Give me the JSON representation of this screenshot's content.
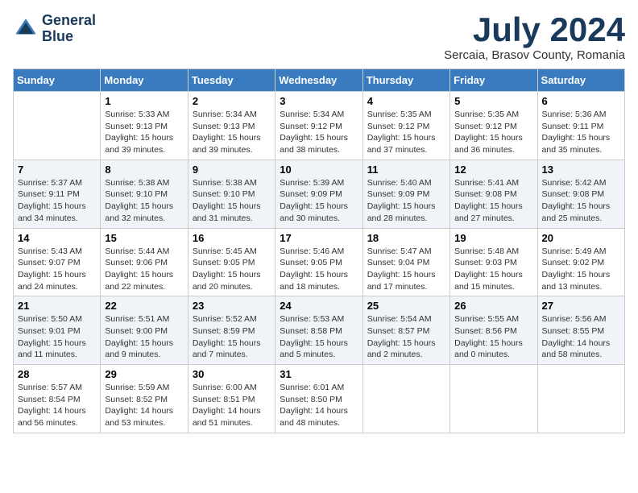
{
  "header": {
    "logo_line1": "General",
    "logo_line2": "Blue",
    "month_year": "July 2024",
    "location": "Sercaia, Brasov County, Romania"
  },
  "weekdays": [
    "Sunday",
    "Monday",
    "Tuesday",
    "Wednesday",
    "Thursday",
    "Friday",
    "Saturday"
  ],
  "weeks": [
    [
      {
        "day": "",
        "info": ""
      },
      {
        "day": "1",
        "info": "Sunrise: 5:33 AM\nSunset: 9:13 PM\nDaylight: 15 hours\nand 39 minutes."
      },
      {
        "day": "2",
        "info": "Sunrise: 5:34 AM\nSunset: 9:13 PM\nDaylight: 15 hours\nand 39 minutes."
      },
      {
        "day": "3",
        "info": "Sunrise: 5:34 AM\nSunset: 9:12 PM\nDaylight: 15 hours\nand 38 minutes."
      },
      {
        "day": "4",
        "info": "Sunrise: 5:35 AM\nSunset: 9:12 PM\nDaylight: 15 hours\nand 37 minutes."
      },
      {
        "day": "5",
        "info": "Sunrise: 5:35 AM\nSunset: 9:12 PM\nDaylight: 15 hours\nand 36 minutes."
      },
      {
        "day": "6",
        "info": "Sunrise: 5:36 AM\nSunset: 9:11 PM\nDaylight: 15 hours\nand 35 minutes."
      }
    ],
    [
      {
        "day": "7",
        "info": "Sunrise: 5:37 AM\nSunset: 9:11 PM\nDaylight: 15 hours\nand 34 minutes."
      },
      {
        "day": "8",
        "info": "Sunrise: 5:38 AM\nSunset: 9:10 PM\nDaylight: 15 hours\nand 32 minutes."
      },
      {
        "day": "9",
        "info": "Sunrise: 5:38 AM\nSunset: 9:10 PM\nDaylight: 15 hours\nand 31 minutes."
      },
      {
        "day": "10",
        "info": "Sunrise: 5:39 AM\nSunset: 9:09 PM\nDaylight: 15 hours\nand 30 minutes."
      },
      {
        "day": "11",
        "info": "Sunrise: 5:40 AM\nSunset: 9:09 PM\nDaylight: 15 hours\nand 28 minutes."
      },
      {
        "day": "12",
        "info": "Sunrise: 5:41 AM\nSunset: 9:08 PM\nDaylight: 15 hours\nand 27 minutes."
      },
      {
        "day": "13",
        "info": "Sunrise: 5:42 AM\nSunset: 9:08 PM\nDaylight: 15 hours\nand 25 minutes."
      }
    ],
    [
      {
        "day": "14",
        "info": "Sunrise: 5:43 AM\nSunset: 9:07 PM\nDaylight: 15 hours\nand 24 minutes."
      },
      {
        "day": "15",
        "info": "Sunrise: 5:44 AM\nSunset: 9:06 PM\nDaylight: 15 hours\nand 22 minutes."
      },
      {
        "day": "16",
        "info": "Sunrise: 5:45 AM\nSunset: 9:05 PM\nDaylight: 15 hours\nand 20 minutes."
      },
      {
        "day": "17",
        "info": "Sunrise: 5:46 AM\nSunset: 9:05 PM\nDaylight: 15 hours\nand 18 minutes."
      },
      {
        "day": "18",
        "info": "Sunrise: 5:47 AM\nSunset: 9:04 PM\nDaylight: 15 hours\nand 17 minutes."
      },
      {
        "day": "19",
        "info": "Sunrise: 5:48 AM\nSunset: 9:03 PM\nDaylight: 15 hours\nand 15 minutes."
      },
      {
        "day": "20",
        "info": "Sunrise: 5:49 AM\nSunset: 9:02 PM\nDaylight: 15 hours\nand 13 minutes."
      }
    ],
    [
      {
        "day": "21",
        "info": "Sunrise: 5:50 AM\nSunset: 9:01 PM\nDaylight: 15 hours\nand 11 minutes."
      },
      {
        "day": "22",
        "info": "Sunrise: 5:51 AM\nSunset: 9:00 PM\nDaylight: 15 hours\nand 9 minutes."
      },
      {
        "day": "23",
        "info": "Sunrise: 5:52 AM\nSunset: 8:59 PM\nDaylight: 15 hours\nand 7 minutes."
      },
      {
        "day": "24",
        "info": "Sunrise: 5:53 AM\nSunset: 8:58 PM\nDaylight: 15 hours\nand 5 minutes."
      },
      {
        "day": "25",
        "info": "Sunrise: 5:54 AM\nSunset: 8:57 PM\nDaylight: 15 hours\nand 2 minutes."
      },
      {
        "day": "26",
        "info": "Sunrise: 5:55 AM\nSunset: 8:56 PM\nDaylight: 15 hours\nand 0 minutes."
      },
      {
        "day": "27",
        "info": "Sunrise: 5:56 AM\nSunset: 8:55 PM\nDaylight: 14 hours\nand 58 minutes."
      }
    ],
    [
      {
        "day": "28",
        "info": "Sunrise: 5:57 AM\nSunset: 8:54 PM\nDaylight: 14 hours\nand 56 minutes."
      },
      {
        "day": "29",
        "info": "Sunrise: 5:59 AM\nSunset: 8:52 PM\nDaylight: 14 hours\nand 53 minutes."
      },
      {
        "day": "30",
        "info": "Sunrise: 6:00 AM\nSunset: 8:51 PM\nDaylight: 14 hours\nand 51 minutes."
      },
      {
        "day": "31",
        "info": "Sunrise: 6:01 AM\nSunset: 8:50 PM\nDaylight: 14 hours\nand 48 minutes."
      },
      {
        "day": "",
        "info": ""
      },
      {
        "day": "",
        "info": ""
      },
      {
        "day": "",
        "info": ""
      }
    ]
  ]
}
